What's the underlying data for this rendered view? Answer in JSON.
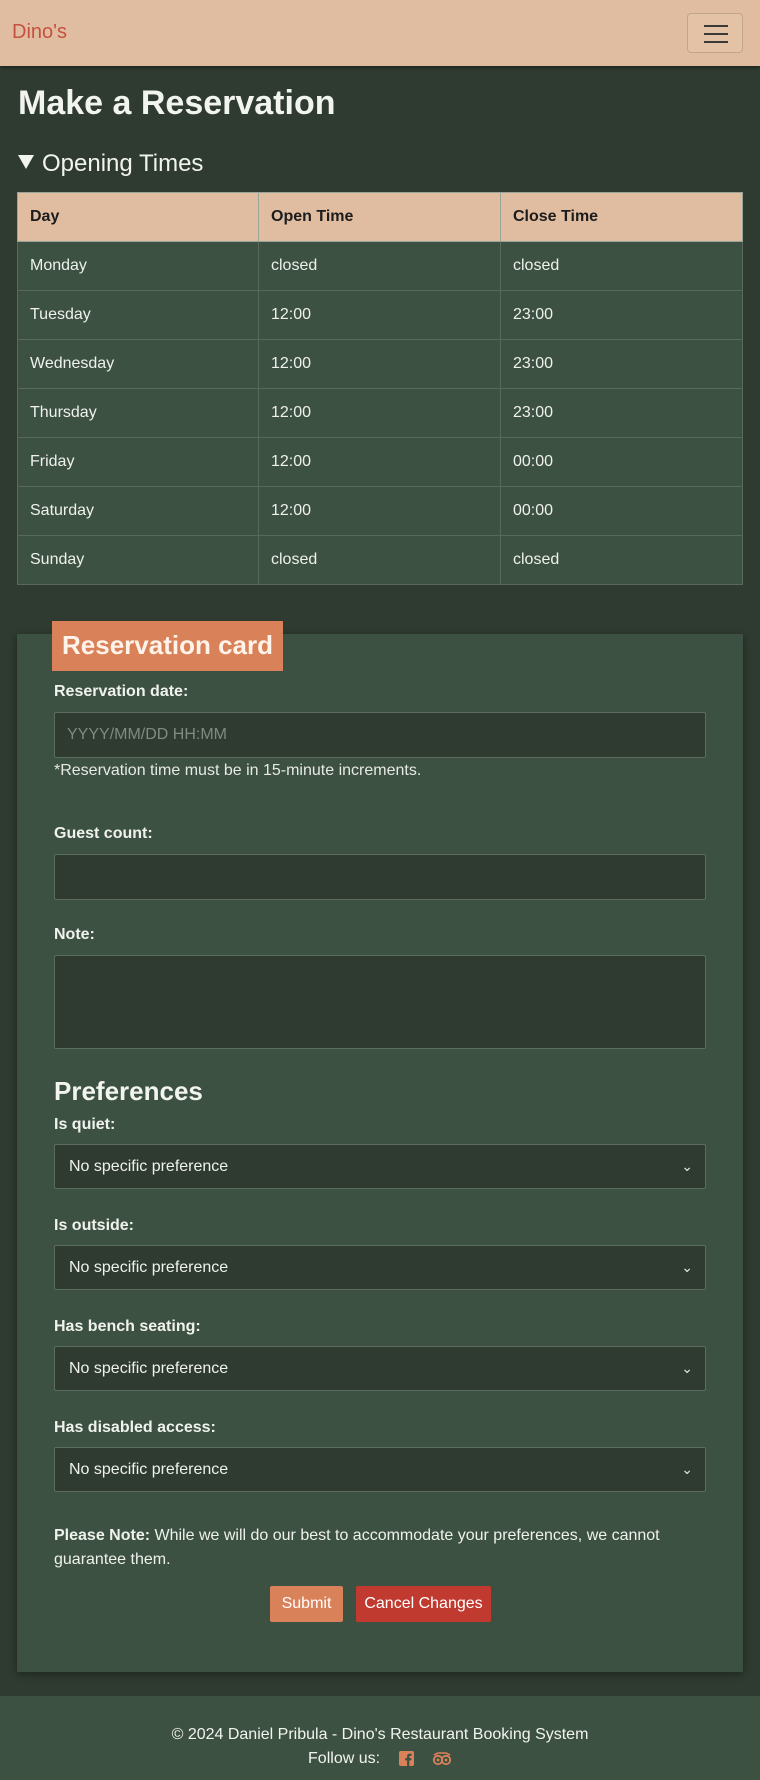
{
  "navbar": {
    "brand": "Dino's",
    "toggle_icon": "hamburger-menu-icon"
  },
  "page": {
    "title": "Make a Reservation"
  },
  "opening_times": {
    "summary": "Opening Times",
    "headers": [
      "Day",
      "Open Time",
      "Close Time"
    ],
    "rows": [
      [
        "Monday",
        "closed",
        "closed"
      ],
      [
        "Tuesday",
        "12:00",
        "23:00"
      ],
      [
        "Wednesday",
        "12:00",
        "23:00"
      ],
      [
        "Thursday",
        "12:00",
        "23:00"
      ],
      [
        "Friday",
        "12:00",
        "00:00"
      ],
      [
        "Saturday",
        "12:00",
        "00:00"
      ],
      [
        "Sunday",
        "closed",
        "closed"
      ]
    ]
  },
  "card": {
    "header": "Reservation card",
    "date_label": "Reservation date:",
    "date_placeholder": "YYYY/MM/DD HH:MM",
    "date_hint": "*Reservation time must be in 15-minute increments.",
    "guest_label": "Guest count:",
    "guest_value": "",
    "note_label": "Note:",
    "note_value": "",
    "preferences_title": "Preferences",
    "preferences": [
      {
        "label": "Is quiet:",
        "value": "No specific preference"
      },
      {
        "label": "Is outside:",
        "value": "No specific preference"
      },
      {
        "label": "Has bench seating:",
        "value": "No specific preference"
      },
      {
        "label": "Has disabled access:",
        "value": "No specific preference"
      }
    ],
    "note_strong": "Please Note:",
    "note_text": " While we will do our best to accommodate your preferences, we cannot guarantee them.",
    "submit_label": "Submit",
    "cancel_label": "Cancel Changes"
  },
  "footer": {
    "copyright": "© 2024 Daniel Pribula - Dino's Restaurant Booking System",
    "follow": "Follow us:",
    "icons": [
      "facebook-icon",
      "tripadvisor-icon"
    ]
  },
  "colors": {
    "background": "#2f3b30",
    "panel": "#3d5142",
    "accent": "#d9825a",
    "nav": "#e0bda1",
    "danger": "#c13a2f"
  }
}
